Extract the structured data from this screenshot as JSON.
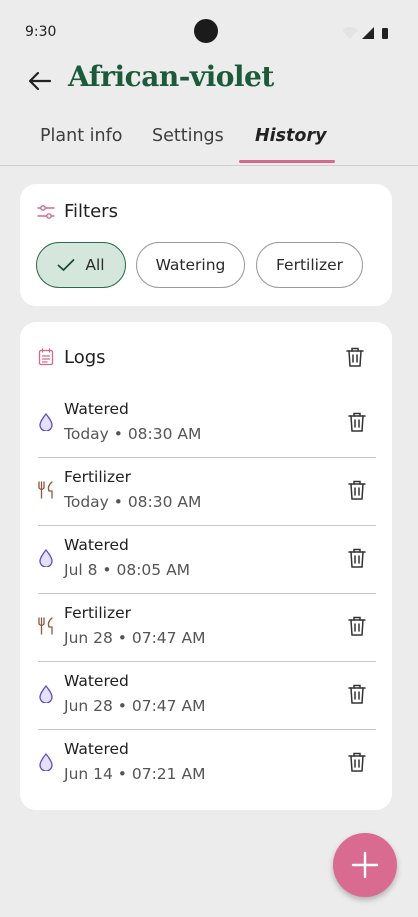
{
  "status": {
    "time": "9:30"
  },
  "header": {
    "title": "African-violet"
  },
  "tabs": [
    {
      "label": "Plant info"
    },
    {
      "label": "Settings"
    },
    {
      "label": "History"
    }
  ],
  "filters": {
    "title": "Filters",
    "chips": [
      {
        "label": "All",
        "selected": true
      },
      {
        "label": "Watering",
        "selected": false
      },
      {
        "label": "Fertilizer",
        "selected": false
      }
    ]
  },
  "logs": {
    "title": "Logs",
    "items": [
      {
        "type": "water",
        "title": "Watered",
        "time": "Today • 08:30 AM"
      },
      {
        "type": "fertilizer",
        "title": "Fertilizer",
        "time": "Today • 08:30 AM"
      },
      {
        "type": "water",
        "title": "Watered",
        "time": "Jul 8 • 08:05 AM"
      },
      {
        "type": "fertilizer",
        "title": "Fertilizer",
        "time": "Jun 28 • 07:47 AM"
      },
      {
        "type": "water",
        "title": "Watered",
        "time": "Jun 28 • 07:47 AM"
      },
      {
        "type": "water",
        "title": "Watered",
        "time": "Jun 14 • 07:21 AM"
      }
    ]
  },
  "colors": {
    "brand_green": "#1c5a3a",
    "accent_pink": "#d96a90",
    "chip_selected_bg": "#d5e7dd",
    "water_icon": "#5b4fc0",
    "fertilizer_icon": "#8a5a3c"
  },
  "icons": {
    "back": "arrow-left-icon",
    "filters": "sliders-icon",
    "logs": "clipboard-icon",
    "water": "water-drop-icon",
    "fertilizer": "fork-knife-icon",
    "delete": "trash-icon",
    "add": "plus-icon"
  }
}
